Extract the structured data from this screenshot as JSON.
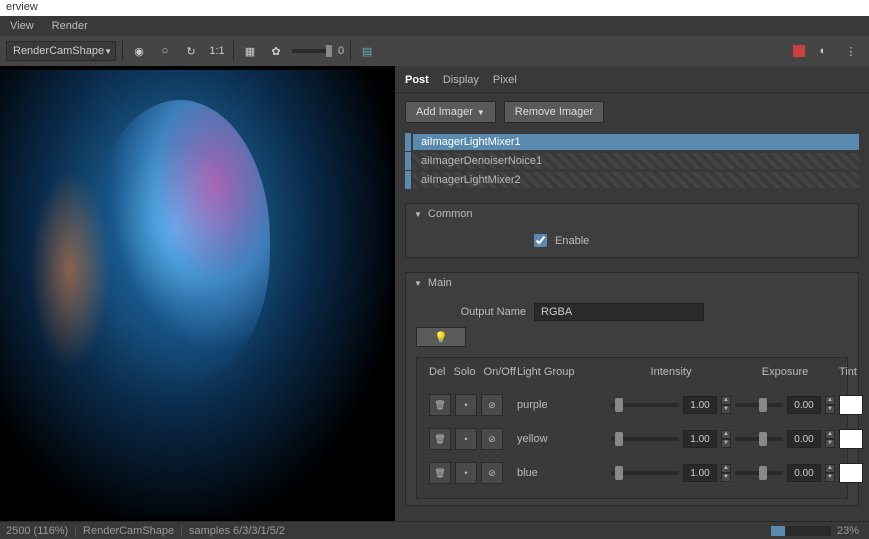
{
  "window": {
    "title": "erview"
  },
  "menu": {
    "view": "View",
    "render": "Render"
  },
  "toolbar": {
    "camera": "RenderCamShape",
    "zoom_label": "1:1",
    "slider_val": "0"
  },
  "tabs": {
    "post": "Post",
    "display": "Display",
    "pixel": "Pixel"
  },
  "buttons": {
    "add_imager": "Add Imager",
    "remove_imager": "Remove Imager"
  },
  "imagers": [
    {
      "name": "aiImagerLightMixer1",
      "selected": true
    },
    {
      "name": "aiImagerDenoiserNoice1",
      "selected": false
    },
    {
      "name": "aiImagerLightMixer2",
      "selected": false
    }
  ],
  "sections": {
    "common": {
      "title": "Common",
      "enable": "Enable"
    },
    "main": {
      "title": "Main",
      "output_label": "Output Name",
      "output_value": "RGBA"
    }
  },
  "grid": {
    "headers": {
      "del": "Del",
      "solo": "Solo",
      "onoff": "On/Off",
      "group": "Light Group",
      "intensity": "Intensity",
      "exposure": "Exposure",
      "tint": "Tint"
    },
    "rows": [
      {
        "group": "purple",
        "intensity": "1.00",
        "exposure": "0.00"
      },
      {
        "group": "yellow",
        "intensity": "1.00",
        "exposure": "0.00"
      },
      {
        "group": "blue",
        "intensity": "1.00",
        "exposure": "0.00"
      }
    ]
  },
  "status": {
    "res": "2500 (116%)",
    "camera": "RenderCamShape",
    "samples": "samples 6/3/3/1/5/2",
    "progress": "23%",
    "progress_pct": 23
  }
}
